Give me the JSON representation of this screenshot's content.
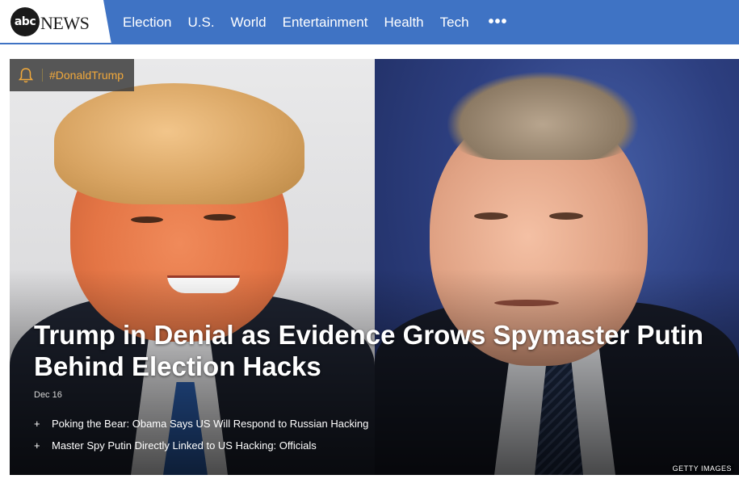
{
  "header": {
    "logo_mark": "abc",
    "logo_word": "NEWS",
    "nav_items": [
      "Election",
      "U.S.",
      "World",
      "Entertainment",
      "Health",
      "Tech"
    ],
    "more_label": "•••"
  },
  "hero": {
    "tag": {
      "icon": "bell-icon",
      "label": "#DonaldTrump"
    },
    "headline": "Trump in Denial as Evidence Grows Spymaster Putin Behind Election Hacks",
    "date": "Dec 16",
    "related": [
      "Poking the Bear: Obama Says US Will Respond to Russian Hacking",
      "Master Spy Putin Directly Linked to US Hacking: Officials"
    ],
    "bullet": "+",
    "image_credit": "GETTY IMAGES"
  },
  "colors": {
    "nav_bg": "#3f73c4",
    "tag_text": "#f2a93b"
  }
}
